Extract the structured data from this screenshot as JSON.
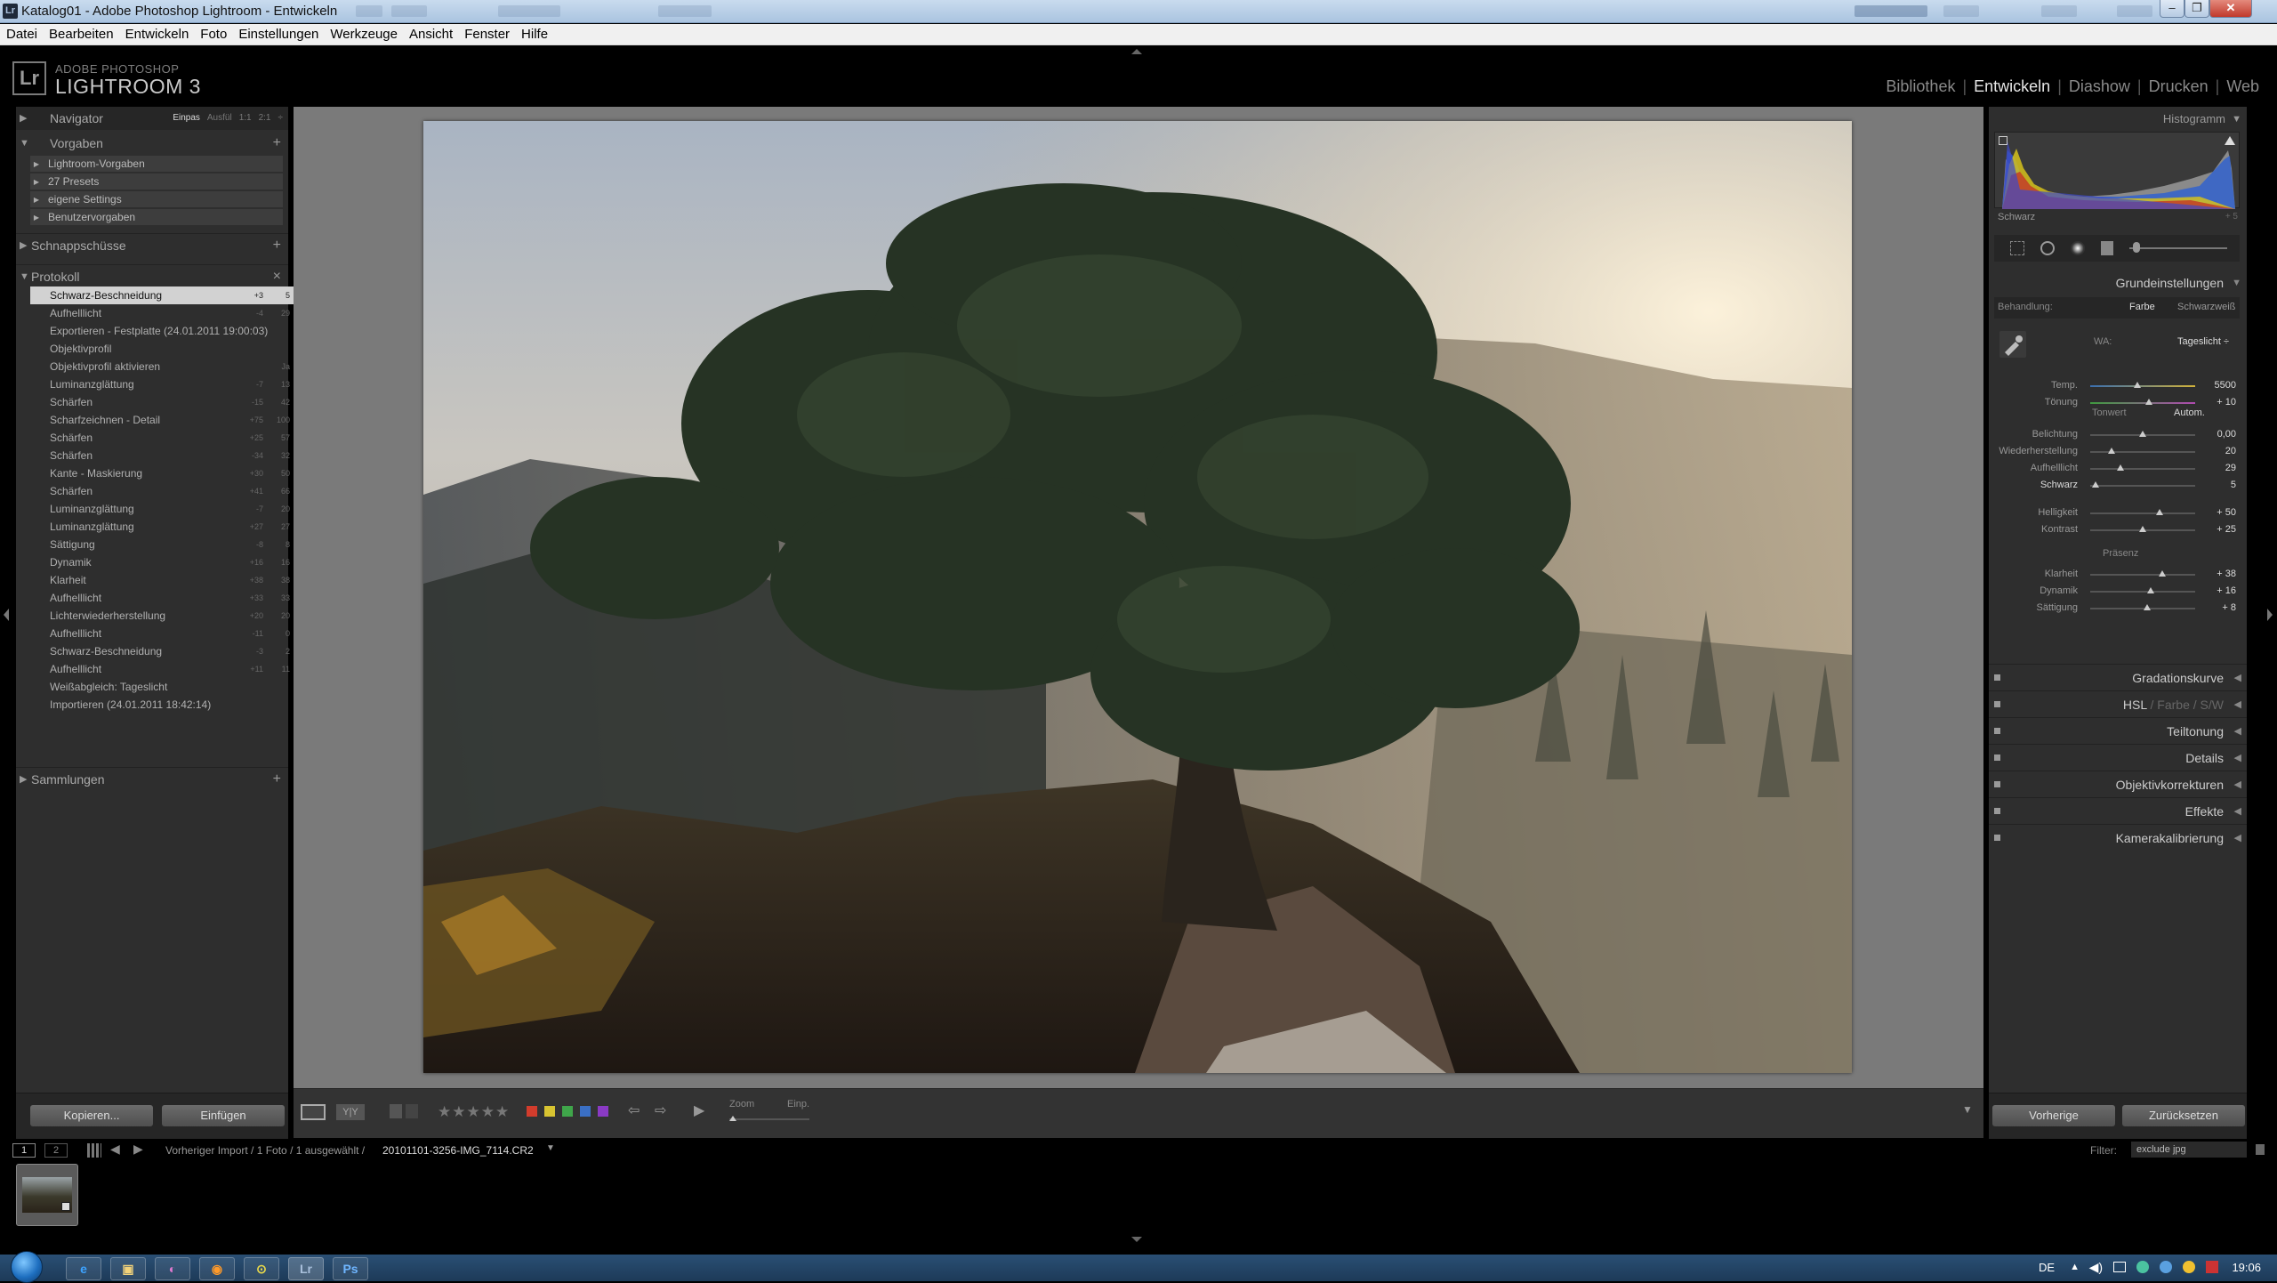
{
  "window": {
    "title": "Katalog01 - Adobe Photoshop Lightroom - Entwickeln",
    "app_icon": "Lr",
    "controls": {
      "minimize": "–",
      "maximize": "❐",
      "close": "✕"
    }
  },
  "menu": [
    "Datei",
    "Bearbeiten",
    "Entwickeln",
    "Foto",
    "Einstellungen",
    "Werkzeuge",
    "Ansicht",
    "Fenster",
    "Hilfe"
  ],
  "header": {
    "logo_box": "Lr",
    "brand_small": "ADOBE PHOTOSHOP",
    "brand_large": "LIGHTROOM 3",
    "modules": [
      "Bibliothek",
      "Entwickeln",
      "Diashow",
      "Drucken",
      "Web"
    ],
    "active_module": "Entwickeln"
  },
  "left": {
    "navigator": {
      "label": "Navigator",
      "tabs": [
        "Einpas",
        "Ausfül",
        "1:1",
        "2:1"
      ]
    },
    "presets": {
      "label": "Vorgaben",
      "items": [
        "Lightroom-Vorgaben",
        "27 Presets",
        "eigene Settings",
        "Benutzervorgaben"
      ]
    },
    "snapshots": {
      "label": "Schnappschüsse"
    },
    "history": {
      "label": "Protokoll",
      "close": "×",
      "items": [
        {
          "name": "Schwarz-Beschneidung",
          "v1": "+3",
          "v2": "5"
        },
        {
          "name": "Aufhelllicht",
          "v1": "-4",
          "v2": "29"
        },
        {
          "name": "Exportieren - Festplatte (24.01.2011 19:00:03)",
          "v1": "",
          "v2": ""
        },
        {
          "name": "Objektivprofil",
          "v1": "",
          "v2": ""
        },
        {
          "name": "Objektivprofil aktivieren",
          "v1": "",
          "v2": "Ja"
        },
        {
          "name": "Luminanzglättung",
          "v1": "-7",
          "v2": "13"
        },
        {
          "name": "Schärfen",
          "v1": "-15",
          "v2": "42"
        },
        {
          "name": "Scharfzeichnen - Detail",
          "v1": "+75",
          "v2": "100"
        },
        {
          "name": "Schärfen",
          "v1": "+25",
          "v2": "57"
        },
        {
          "name": "Schärfen",
          "v1": "-34",
          "v2": "32"
        },
        {
          "name": "Kante - Maskierung",
          "v1": "+30",
          "v2": "50"
        },
        {
          "name": "Schärfen",
          "v1": "+41",
          "v2": "66"
        },
        {
          "name": "Luminanzglättung",
          "v1": "-7",
          "v2": "20"
        },
        {
          "name": "Luminanzglättung",
          "v1": "+27",
          "v2": "27"
        },
        {
          "name": "Sättigung",
          "v1": "-8",
          "v2": "8"
        },
        {
          "name": "Dynamik",
          "v1": "+16",
          "v2": "16"
        },
        {
          "name": "Klarheit",
          "v1": "+38",
          "v2": "38"
        },
        {
          "name": "Aufhelllicht",
          "v1": "+33",
          "v2": "33"
        },
        {
          "name": "Lichterwiederherstellung",
          "v1": "+20",
          "v2": "20"
        },
        {
          "name": "Aufhelllicht",
          "v1": "-11",
          "v2": "0"
        },
        {
          "name": "Schwarz-Beschneidung",
          "v1": "-3",
          "v2": "2"
        },
        {
          "name": "Aufhelllicht",
          "v1": "+11",
          "v2": "11"
        },
        {
          "name": "Weißabgleich: Tageslicht",
          "v1": "",
          "v2": ""
        },
        {
          "name": "Importieren (24.01.2011 18:42:14)",
          "v1": "",
          "v2": ""
        }
      ]
    },
    "collections": {
      "label": "Sammlungen"
    },
    "copy_button": "Kopieren...",
    "paste_button": "Einfügen"
  },
  "toolbar": {
    "zoom_label": "Zoom",
    "zoom_value": "Einp.",
    "rating_stars": "★★★★★",
    "color_labels": [
      "#d23c2c",
      "#d8c431",
      "#3fa64a",
      "#3a6fc4",
      "#8a3ac4"
    ]
  },
  "right": {
    "histogram_label": "Histogramm",
    "histogram_readout": "Schwarz",
    "histogram_readout_value": "+ 5",
    "basic_label": "Grundeinstellungen",
    "treatment_label": "Behandlung:",
    "treatment_options": [
      "Farbe",
      "Schwarzweiß"
    ],
    "wb_label": "WA:",
    "wb_value": "Tageslicht ÷",
    "temp": {
      "label": "Temp.",
      "value": "5500",
      "pos": 0.45
    },
    "tint": {
      "label": "Tönung",
      "value": "+ 10",
      "pos": 0.56
    },
    "tone_label": "Tonwert",
    "auto_label": "Autom.",
    "tone_sliders": [
      {
        "label": "Belichtung",
        "value": "0,00",
        "pos": 0.5
      },
      {
        "label": "Wiederherstellung",
        "value": "20",
        "pos": 0.2
      },
      {
        "label": "Aufhelllicht",
        "value": "29",
        "pos": 0.29
      },
      {
        "label": "Schwarz",
        "value": "5",
        "pos": 0.05
      }
    ],
    "tone_sliders2": [
      {
        "label": "Helligkeit",
        "value": "+ 50",
        "pos": 0.66
      },
      {
        "label": "Kontrast",
        "value": "+ 25",
        "pos": 0.5
      }
    ],
    "presence_label": "Präsenz",
    "presence_sliders": [
      {
        "label": "Klarheit",
        "value": "+ 38",
        "pos": 0.69
      },
      {
        "label": "Dynamik",
        "value": "+ 16",
        "pos": 0.58
      },
      {
        "label": "Sättigung",
        "value": "+ 8",
        "pos": 0.54
      }
    ],
    "sections": [
      "Gradationskurve",
      "Teiltonung",
      "Details",
      "Objektivkorrekturen",
      "Effekte",
      "Kamerakalibrierung"
    ],
    "hsl": {
      "a": "HSL",
      "b": "Farbe",
      "c": "S/W",
      "sep": "/"
    },
    "prev_button": "Vorherige",
    "reset_button": "Zurücksetzen"
  },
  "filmbar": {
    "page1": "1",
    "page2": "2",
    "path": "Vorheriger Import / 1 Foto / 1 ausgewählt /",
    "filename": "20101101-3256-IMG_7114.CR2",
    "filter_label": "Filter:",
    "filter_value": "exclude jpg"
  },
  "taskbar": {
    "lang": "DE",
    "time": "19:06",
    "apps": [
      "e",
      "▣",
      "◐",
      "◉",
      "⊙",
      "Lr",
      "Ps"
    ]
  }
}
